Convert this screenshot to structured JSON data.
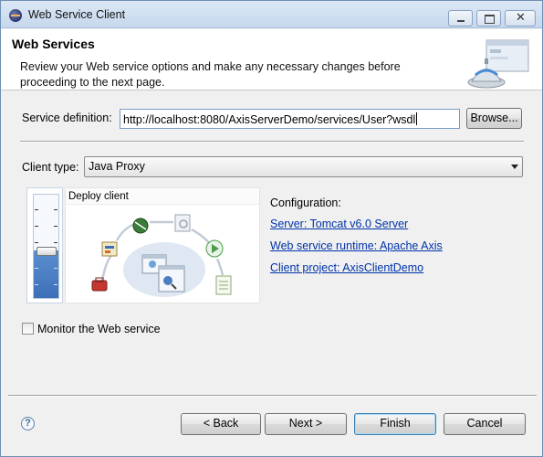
{
  "window": {
    "title": "Web Service Client",
    "close_glyph": "✕"
  },
  "header": {
    "title": "Web Services",
    "description": "Review your Web service options and make any necessary changes before proceeding to the next page.",
    "graphic": "web-service-wizard-banner"
  },
  "service_definition": {
    "label": "Service definition:",
    "value": "http://localhost:8080/AxisServerDemo/services/User?wsdl",
    "browse_label": "Browse..."
  },
  "client_type": {
    "label": "Client type:",
    "selected": "Java Proxy"
  },
  "slider": {
    "level_fraction": 0.46,
    "stage_label": "Deploy client"
  },
  "configuration": {
    "heading": "Configuration:",
    "server_link": "Server: Tomcat v6.0 Server",
    "runtime_link": "Web service runtime: Apache Axis",
    "project_link": "Client project: AxisClientDemo"
  },
  "monitor": {
    "label": "Monitor the Web service",
    "checked": false
  },
  "footer": {
    "help_glyph": "?",
    "back_label": "< Back",
    "next_label": "Next >",
    "finish_label": "Finish",
    "cancel_label": "Cancel"
  },
  "colors": {
    "link": "#0033aa",
    "slider_fill": "#3d6fb8",
    "titlebar": "#c6d8ee"
  }
}
